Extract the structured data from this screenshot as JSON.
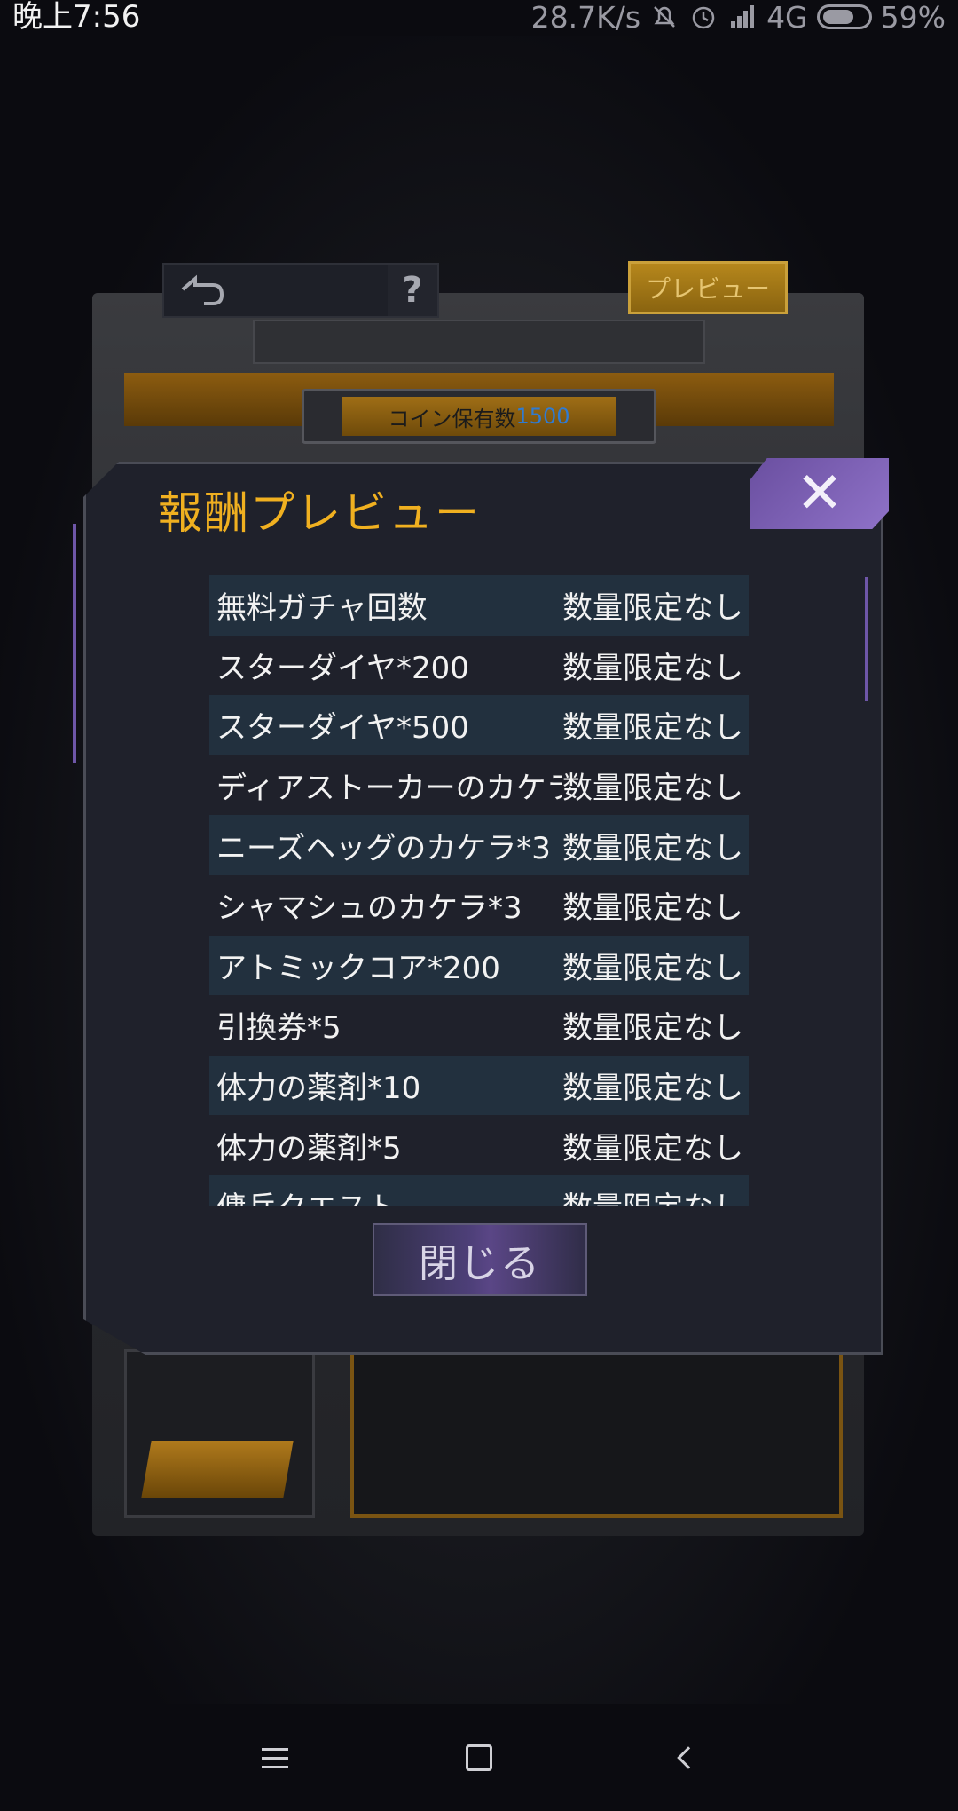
{
  "status_bar": {
    "time": "晚上7:56",
    "network_speed": "28.7K/s",
    "network": "4G",
    "battery": "59%"
  },
  "game": {
    "help_label": "?",
    "preview_button": "プレビュー",
    "coin_label": "コイン保有数",
    "coin_value": "1500"
  },
  "dialog": {
    "title": "報酬プレビュー",
    "close_label": "閉じる",
    "rows": [
      {
        "name": "無料ガチャ回数",
        "qty": "数量限定なし"
      },
      {
        "name": "スターダイヤ*200",
        "qty": "数量限定なし"
      },
      {
        "name": "スターダイヤ*500",
        "qty": "数量限定なし"
      },
      {
        "name": "ディアストーカーのカケラ",
        "qty": "数量限定なし"
      },
      {
        "name": "ニーズヘッグのカケラ*3",
        "qty": "数量限定なし"
      },
      {
        "name": "シャマシュのカケラ*3",
        "qty": "数量限定なし"
      },
      {
        "name": "アトミックコア*200",
        "qty": "数量限定なし"
      },
      {
        "name": "引換券*5",
        "qty": "数量限定なし"
      },
      {
        "name": "体力の薬剤*10",
        "qty": "数量限定なし"
      },
      {
        "name": "体力の薬剤*5",
        "qty": "数量限定なし"
      },
      {
        "name": "傭兵クエスト",
        "qty": "数量限定なし"
      }
    ]
  },
  "icons": [
    "mute-bell-icon",
    "alarm-icon",
    "signal-icon",
    "battery-icon",
    "back-arrow-icon",
    "close-x-icon",
    "menu-icon",
    "home-icon",
    "nav-back-icon"
  ],
  "colors": {
    "title": "#f0b020",
    "accent_purple": "#7a5fb8",
    "row_alt": "#22303e",
    "coin_value": "#2f7bd3"
  }
}
